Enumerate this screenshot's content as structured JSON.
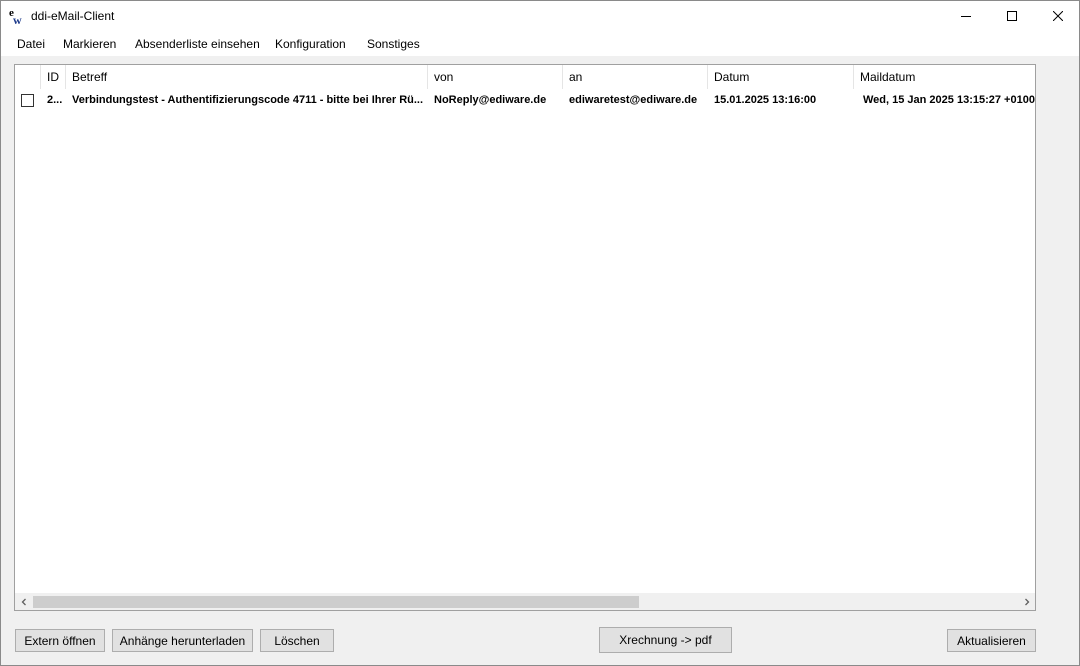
{
  "window": {
    "title": "ddi-eMail-Client",
    "icon": "ew-logo-icon"
  },
  "menu": {
    "items": [
      "Datei",
      "Markieren",
      "Absenderliste einsehen",
      "Konfiguration",
      "Sonstiges"
    ]
  },
  "table": {
    "columns": [
      "ID",
      "Betreff",
      "von",
      "an",
      "Datum",
      "Maildatum"
    ],
    "rows": [
      {
        "checked": false,
        "id": "2...",
        "betreff": "Verbindungstest - Authentifizierungscode 4711 - bitte bei Ihrer Rü...",
        "von": "NoReply@ediware.de",
        "an": "ediwaretest@ediware.de",
        "datum": "15.01.2025 13:16:00",
        "maildatum": "Wed, 15 Jan 2025 13:15:27 +0100"
      }
    ]
  },
  "buttons": {
    "extern_oeffnen": "Extern öffnen",
    "anhaenge": "Anhänge herunterladen",
    "loeschen": "Löschen",
    "xrechnung": "Xrechnung -> pdf",
    "aktualisieren": "Aktualisieren"
  }
}
